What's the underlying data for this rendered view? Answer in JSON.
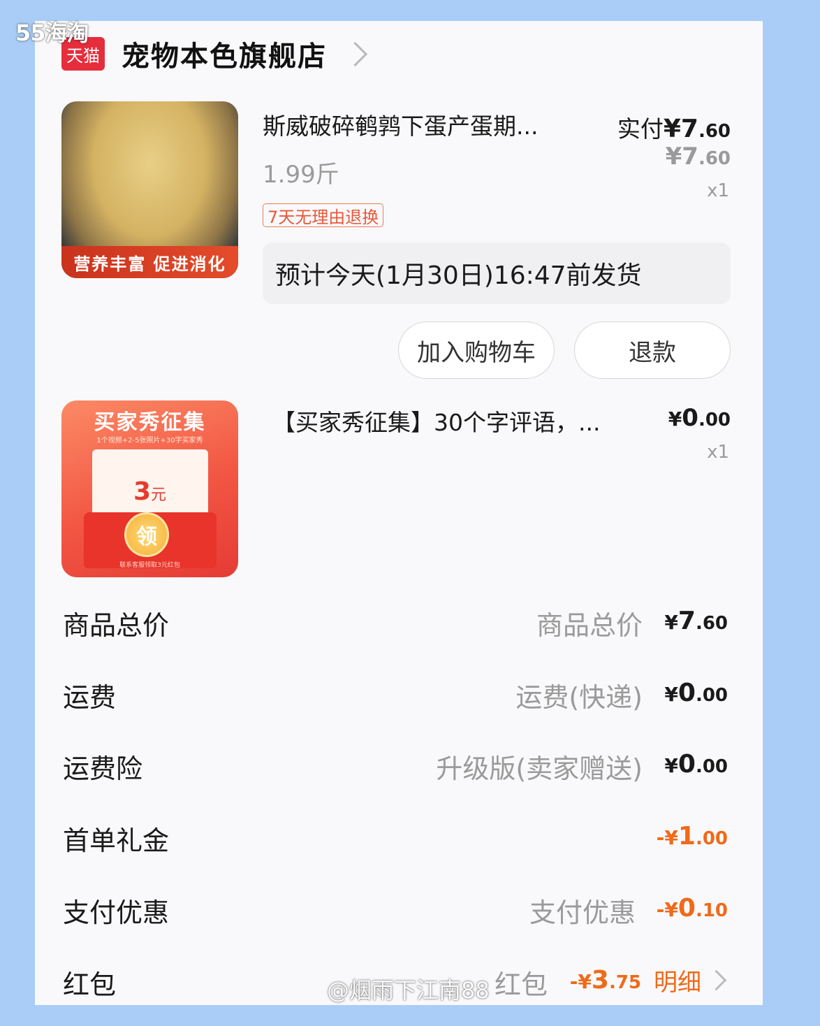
{
  "watermark_top": "55海淘",
  "store": {
    "badge": "天猫",
    "name": "宠物本色旗舰店"
  },
  "items": [
    {
      "title": "斯威破碎鹌鹑下蛋产蛋期...",
      "price_label": "实付",
      "price_currency": "¥",
      "price_int": "7",
      "price_dec": ".60",
      "orig_currency": "¥",
      "orig_int": "7",
      "orig_dec": ".60",
      "qty": "x1",
      "spec": "1.99斤",
      "tag": "7天无理由退换",
      "shipping": "预计今天(1月30日)16:47前发货",
      "thumb_text": "营养丰富 促进消化",
      "buttons": {
        "add_to_cart": "加入购物车",
        "refund": "退款"
      }
    },
    {
      "title": "【买家秀征集】30个字评语，...",
      "price_currency": "¥",
      "price_int": "0",
      "price_dec": ".00",
      "qty": "x1",
      "thumb": {
        "title": "买家秀征集",
        "subtitle": "1个视频+2-5张照片+30字买家秀",
        "amount": "3",
        "unit": "元",
        "claim": "领",
        "footer": "联系客服领取3元红包"
      }
    }
  ],
  "summary": [
    {
      "label": "商品总价",
      "detail": "商品总价",
      "cur": "¥",
      "int": "7",
      "dec": ".60"
    },
    {
      "label": "运费",
      "detail": "运费(快递)",
      "cur": "¥",
      "int": "0",
      "dec": ".00"
    },
    {
      "label": "运费险",
      "detail": "升级版(卖家赠送)",
      "cur": "¥",
      "int": "0",
      "dec": ".00"
    },
    {
      "label": "首单礼金",
      "detail": "",
      "cur": "-¥",
      "int": "1",
      "dec": ".00"
    },
    {
      "label": "支付优惠",
      "detail": "支付优惠",
      "cur": "-¥",
      "int": "0",
      "dec": ".10"
    },
    {
      "label": "红包",
      "detail": "红包",
      "cur": "-¥",
      "int": "3",
      "dec": ".75",
      "link": "明细"
    }
  ],
  "watermark_bottom": "@烟雨下江南88",
  "colors": {
    "accent": "#ef6a1a",
    "tmall_red": "#e62d3c",
    "background": "#a9cdf6"
  }
}
